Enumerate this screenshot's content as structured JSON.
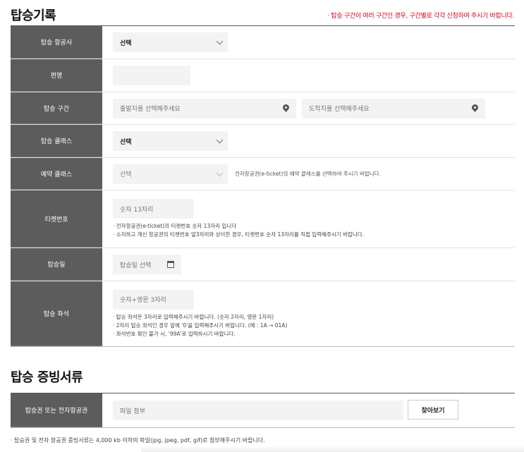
{
  "boarding": {
    "title": "탑승기록",
    "notice": "· 탑승 구간이 여러 구간인 경우, 구간별로 각각 신청하여 주시기 바랍니다.",
    "rows": {
      "airline": {
        "label": "탑승 항공사",
        "value": "선택"
      },
      "flight": {
        "label": "편명",
        "value": ""
      },
      "route": {
        "label": "탑승 구간",
        "from_placeholder": "출발지를 선택해주세요",
        "to_placeholder": "도착지를 선택해주세요"
      },
      "class": {
        "label": "탑승 클래스",
        "value": "선택"
      },
      "booking_class": {
        "label": "예약 클래스",
        "value": "선택",
        "help": "전자항공권(e-ticket)의 예약 클래스를 선택하여 주시기 바랍니다."
      },
      "ticket": {
        "label": "티켓번호",
        "placeholder": "숫자 13자리",
        "help": [
          "· 전자항공권(e-ticket)의 티켓번호 숫자 13자리 입니다",
          "· 소지하고 계신 항공권의 티켓번호 앞3자리와 상이한 경우, 티켓번호 숫자 13자리를 직접 입력해주시기 바랍니다."
        ]
      },
      "date": {
        "label": "탑승일",
        "placeholder": "탑승일 선택"
      },
      "seat": {
        "label": "탑승 좌석",
        "placeholder": "숫자+영문 3자리",
        "help": [
          "· 탑승 좌석은 3자리로 입력해주시기 바랍니다. (숫자 2자리, 영문 1자리)",
          "· 2자리 탑승 좌석인 경우 앞에 '0'을 입력해주시기 바랍니다. (예 : 1A → 01A)",
          "· 좌석번호 확인 불가 시, '99A'로 입력하시기 바랍니다."
        ]
      }
    }
  },
  "documents": {
    "title": "탑승 증빙서류",
    "label": "탑승권 또는 전자항공권",
    "file_placeholder": "파일 첨부",
    "browse_label": "찾아보기",
    "footnote": "· 탑승권 및 전자 항공권 증빙서류는 4,000 kb 이하의 파일(jpg, jpeg, pdf, gif)로 첨부해주시기 바랍니다."
  },
  "icons": {
    "select": "chevron-down-icon",
    "location": "map-pin-icon",
    "date": "calendar-icon"
  }
}
